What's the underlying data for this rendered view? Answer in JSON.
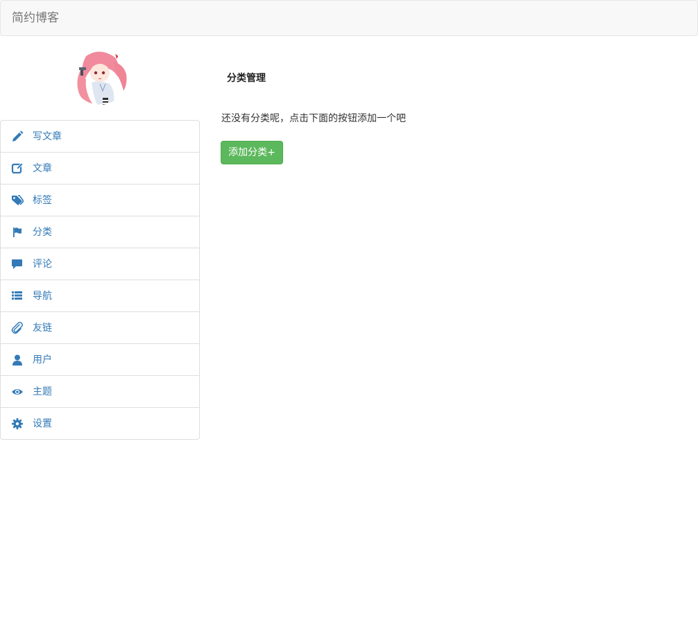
{
  "navbar": {
    "brand": "简约博客"
  },
  "sidebar": {
    "items": [
      {
        "label": "写文章",
        "icon": "pencil-icon"
      },
      {
        "label": "文章",
        "icon": "edit-icon"
      },
      {
        "label": "标签",
        "icon": "tags-icon"
      },
      {
        "label": "分类",
        "icon": "flag-icon"
      },
      {
        "label": "评论",
        "icon": "comment-icon"
      },
      {
        "label": "导航",
        "icon": "list-icon"
      },
      {
        "label": "友链",
        "icon": "paperclip-icon"
      },
      {
        "label": "用户",
        "icon": "user-icon"
      },
      {
        "label": "主题",
        "icon": "eye-icon"
      },
      {
        "label": "设置",
        "icon": "cog-icon"
      }
    ]
  },
  "main": {
    "title": "分类管理",
    "empty_text": "还没有分类呢，点击下面的按钮添加一个吧",
    "add_button": "添加分类+"
  },
  "colors": {
    "link": "#337ab7",
    "success": "#5cb85c",
    "navbar_bg": "#f8f8f8"
  }
}
